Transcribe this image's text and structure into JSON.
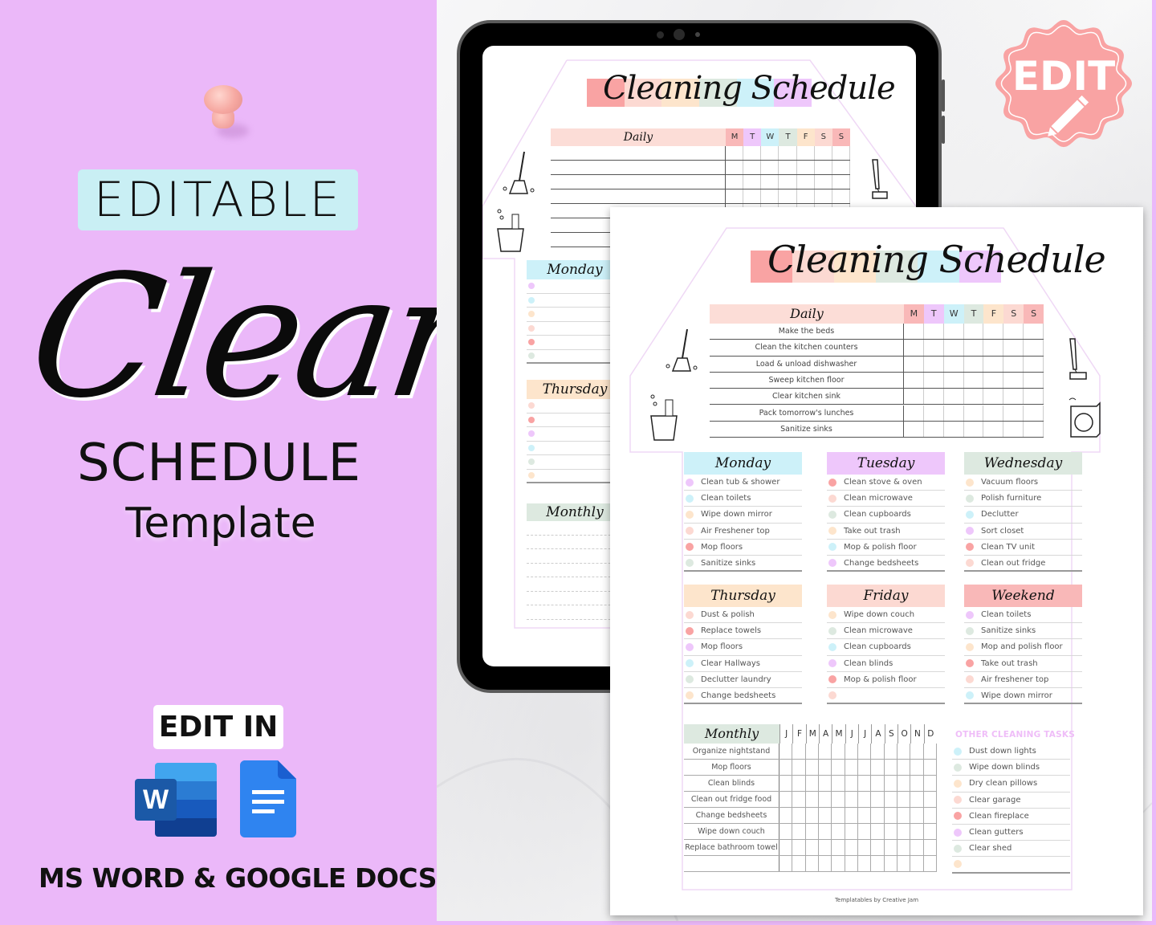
{
  "left_panel": {
    "badge_top": "EDITABLE",
    "script_title": "Cleaning",
    "subtitle": "SCHEDULE",
    "subtitle2": "Template",
    "edit_in": "EDIT IN",
    "word_letter": "W",
    "apps_line": "MS WORD & GOOGLE DOCS",
    "colors": {
      "background": "#ebb8f9",
      "badge": "#c9eff4"
    }
  },
  "stamp": {
    "label": "EDIT",
    "icon": "pencil-icon",
    "color": "#f9a3a3"
  },
  "palette": {
    "pink_red": "#f9a3a3",
    "peach": "#fcd9d2",
    "cream": "#fde5cc",
    "sage": "#dde9e0",
    "sky": "#cdf1f9",
    "lilac": "#eec7fb",
    "daily_head": "#fcddd7"
  },
  "tablet_page": {
    "title": "Cleaning Schedule",
    "daily_label": "Daily",
    "sections": [
      "Monday",
      "Thursday",
      "Monthly"
    ]
  },
  "paper": {
    "title": "Cleaning Schedule",
    "daily": {
      "label": "Daily",
      "days": [
        "M",
        "T",
        "W",
        "T",
        "F",
        "S",
        "S"
      ],
      "tasks": [
        "Make the beds",
        "Clean the kitchen counters",
        "Load & unload dishwasher",
        "Sweep kitchen floor",
        "Clear kitchen sink",
        "Pack tomorrow's lunches",
        "Sanitize sinks"
      ]
    },
    "weekdays": [
      {
        "label": "Monday",
        "color": "#cdf1f9",
        "items": [
          {
            "text": "Clean tub & shower",
            "dot": "#eec7fb"
          },
          {
            "text": "Clean toilets",
            "dot": "#cdf1f9"
          },
          {
            "text": "Wipe down mirror",
            "dot": "#fde5cc"
          },
          {
            "text": "Air Freshener top",
            "dot": "#fcd9d2"
          },
          {
            "text": "Mop floors",
            "dot": "#f9a3a3"
          },
          {
            "text": "Sanitize sinks",
            "dot": "#dde9e0"
          }
        ]
      },
      {
        "label": "Tuesday",
        "color": "#eec7fb",
        "items": [
          {
            "text": "Clean stove & oven",
            "dot": "#f9a3a3"
          },
          {
            "text": "Clean microwave",
            "dot": "#fcd9d2"
          },
          {
            "text": "Clean cupboards",
            "dot": "#dde9e0"
          },
          {
            "text": "Take out trash",
            "dot": "#fde5cc"
          },
          {
            "text": "Mop & polish floor",
            "dot": "#cdf1f9"
          },
          {
            "text": "Change bedsheets",
            "dot": "#eec7fb"
          }
        ]
      },
      {
        "label": "Wednesday",
        "color": "#dde9e0",
        "items": [
          {
            "text": "Vacuum floors",
            "dot": "#fde5cc"
          },
          {
            "text": "Polish furniture",
            "dot": "#dde9e0"
          },
          {
            "text": "Declutter",
            "dot": "#cdf1f9"
          },
          {
            "text": "Sort closet",
            "dot": "#eec7fb"
          },
          {
            "text": "Clean TV unit",
            "dot": "#f9a3a3"
          },
          {
            "text": "Clean out fridge",
            "dot": "#fcd9d2"
          }
        ]
      },
      {
        "label": "Thursday",
        "color": "#fde5cc",
        "items": [
          {
            "text": "Dust & polish",
            "dot": "#fcd9d2"
          },
          {
            "text": "Replace towels",
            "dot": "#f9a3a3"
          },
          {
            "text": "Mop floors",
            "dot": "#eec7fb"
          },
          {
            "text": "Clear Hallways",
            "dot": "#cdf1f9"
          },
          {
            "text": "Declutter laundry",
            "dot": "#dde9e0"
          },
          {
            "text": "Change bedsheets",
            "dot": "#fde5cc"
          }
        ]
      },
      {
        "label": "Friday",
        "color": "#fcd9d2",
        "items": [
          {
            "text": "Wipe down couch",
            "dot": "#fde5cc"
          },
          {
            "text": "Clean microwave",
            "dot": "#dde9e0"
          },
          {
            "text": "Clean cupboards",
            "dot": "#cdf1f9"
          },
          {
            "text": "Clean blinds",
            "dot": "#eec7fb"
          },
          {
            "text": "Mop & polish floor",
            "dot": "#f9a3a3"
          },
          {
            "text": "",
            "dot": "#fcd9d2"
          }
        ]
      },
      {
        "label": "Weekend",
        "color": "#f9b8b8",
        "items": [
          {
            "text": "Clean toilets",
            "dot": "#eec7fb"
          },
          {
            "text": "Sanitize sinks",
            "dot": "#dde9e0"
          },
          {
            "text": "Mop and polish floor",
            "dot": "#fde5cc"
          },
          {
            "text": "Take out trash",
            "dot": "#f9a3a3"
          },
          {
            "text": "Air freshener top",
            "dot": "#fcd9d2"
          },
          {
            "text": "Wipe down mirror",
            "dot": "#cdf1f9"
          }
        ]
      }
    ],
    "monthly": {
      "label": "Monthly",
      "months": [
        "J",
        "F",
        "M",
        "A",
        "M",
        "J",
        "J",
        "A",
        "S",
        "O",
        "N",
        "D"
      ],
      "tasks": [
        "Organize nightstand",
        "Mop floors",
        "Clean blinds",
        "Clean out fridge food",
        "Change bedsheets",
        "Wipe down couch",
        "Replace bathroom towel",
        ""
      ]
    },
    "other": {
      "title": "OTHER CLEANING TASKS",
      "items": [
        {
          "text": "Dust down lights",
          "dot": "#cdf1f9"
        },
        {
          "text": "Wipe down blinds",
          "dot": "#dde9e0"
        },
        {
          "text": "Dry clean pillows",
          "dot": "#fde5cc"
        },
        {
          "text": "Clear garage",
          "dot": "#fcd9d2"
        },
        {
          "text": "Clean fireplace",
          "dot": "#f9a3a3"
        },
        {
          "text": "Clean gutters",
          "dot": "#eec7fb"
        },
        {
          "text": "Clear shed",
          "dot": "#dde9e0"
        },
        {
          "text": "",
          "dot": "#fde5cc"
        }
      ]
    },
    "stickers": [
      "broom-icon",
      "cleaning-bucket-icon",
      "vacuum-icon",
      "washing-machine-icon"
    ],
    "footer": "Templatables by Creative Jam"
  }
}
